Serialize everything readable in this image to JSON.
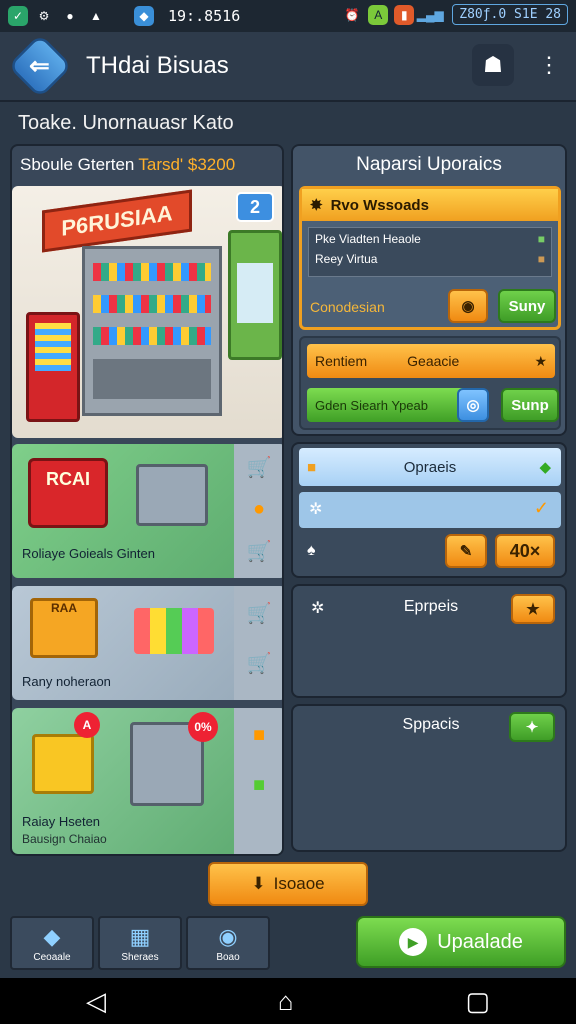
{
  "status": {
    "time": "19:.8516",
    "battery": "Z80ƒ.0 Ѕ1E 28"
  },
  "appbar": {
    "title": "THdai Bisuas"
  },
  "subtitle": "Toake. Unornauasr Kato",
  "left": {
    "header": "Sboule Gterten",
    "header_accent": "Tarsd' $3200",
    "store_sign": "P6RUSIAA",
    "store_badge": "2",
    "cards": [
      {
        "sign": "RCAI",
        "caption": "Roliaye Goieals Ginten"
      },
      {
        "sign": "RAA",
        "caption": "Rany noheraon"
      },
      {
        "sign": "0%",
        "caption": "Raiay Hseten",
        "caption2": "Bausign Chaiao"
      }
    ]
  },
  "right": {
    "header": "Naparsi Uporaics",
    "p1": {
      "title": "Rvo Wssoads",
      "row1": "Pke Viadten Heaole",
      "row2": "Reey Virtua",
      "foot": "Conodesian",
      "btn": "Suny"
    },
    "p2": {
      "row1a": "Rentiem",
      "row1b": "Geaacie",
      "row2": "Gden  Siearh  Ypeab",
      "btn": "Sunp"
    },
    "p3": {
      "title": "Opraeis",
      "row3_btn": "40×"
    },
    "p4": {
      "title": "Eprpeis"
    },
    "p5": {
      "title": "Sppacis"
    }
  },
  "center_btn": "Isoaoe",
  "nav": [
    {
      "label": "Ceoaale"
    },
    {
      "label": "Sheraes"
    },
    {
      "label": "Boao"
    }
  ],
  "upgrade": "Upaalade"
}
